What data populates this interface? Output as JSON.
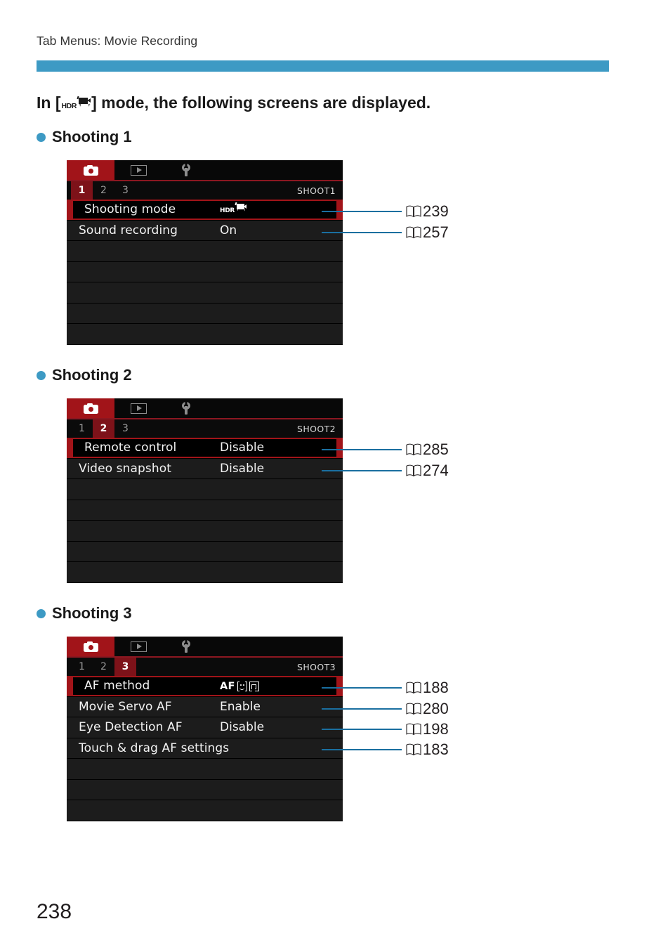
{
  "running_head": "Tab Menus: Movie Recording",
  "intro": {
    "prefix": "In [",
    "mode_icon": "hdr-movie-icon",
    "mode_icon_label": "HDR",
    "suffix": "] mode, the following screens are displayed."
  },
  "folio": "238",
  "colors": {
    "accent_blue": "#3d9ac4",
    "leader_blue": "#1a6fa0",
    "menu_red": "#a11419",
    "tab_active_red": "#7d1219",
    "menu_dark": "#1c1c1c",
    "menu_black": "#000000"
  },
  "sections": [
    {
      "heading": "Shooting 1",
      "screen": {
        "tabs": [
          {
            "icon": "camera-icon",
            "active": true
          },
          {
            "icon": "playback-icon",
            "active": false
          },
          {
            "icon": "wrench-icon",
            "active": false
          }
        ],
        "tab_numbers": [
          "1",
          "2",
          "3"
        ],
        "active_tab_number": "1",
        "shoot_label": "SHOOT1",
        "rows": [
          {
            "label": "Shooting mode",
            "value": "",
            "value_icon": "hdr-movie-icon",
            "selected": true,
            "page": "239"
          },
          {
            "label": "Sound recording",
            "value": "On",
            "selected": false,
            "page": "257"
          }
        ],
        "empty_rows": 5
      }
    },
    {
      "heading": "Shooting 2",
      "screen": {
        "tabs": [
          {
            "icon": "camera-icon",
            "active": true
          },
          {
            "icon": "playback-icon",
            "active": false
          },
          {
            "icon": "wrench-icon",
            "active": false
          }
        ],
        "tab_numbers": [
          "1",
          "2",
          "3"
        ],
        "active_tab_number": "2",
        "shoot_label": "SHOOT2",
        "rows": [
          {
            "label": "Remote control",
            "value": "Disable",
            "selected": true,
            "page": "285"
          },
          {
            "label": "Video snapshot",
            "value": "Disable",
            "selected": false,
            "page": "274"
          }
        ],
        "empty_rows": 5
      }
    },
    {
      "heading": "Shooting 3",
      "screen": {
        "tabs": [
          {
            "icon": "camera-icon",
            "active": true
          },
          {
            "icon": "playback-icon",
            "active": false
          },
          {
            "icon": "wrench-icon",
            "active": false
          }
        ],
        "tab_numbers": [
          "1",
          "2",
          "3"
        ],
        "active_tab_number": "3",
        "shoot_label": "SHOOT3",
        "rows": [
          {
            "label": "AF method",
            "value": "AF",
            "value_icon": "af-face-frame-icon",
            "selected": true,
            "page": "188"
          },
          {
            "label": "Movie Servo AF",
            "value": "Enable",
            "selected": false,
            "page": "280"
          },
          {
            "label": "Eye Detection AF",
            "value": "Disable",
            "selected": false,
            "page": "198"
          },
          {
            "label": "Touch & drag AF settings",
            "value": "",
            "selected": false,
            "page": "183"
          }
        ],
        "empty_rows": 3
      }
    }
  ]
}
